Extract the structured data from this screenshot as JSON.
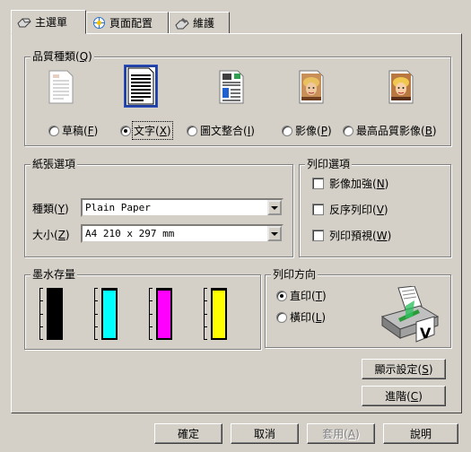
{
  "tabs": [
    {
      "label": "主選單",
      "icon": "main-menu-icon",
      "active": true
    },
    {
      "label": "頁面配置",
      "icon": "page-layout-icon",
      "active": false
    },
    {
      "label": "維護",
      "icon": "maintenance-icon",
      "active": false
    }
  ],
  "quality": {
    "title": "品質種類(",
    "title_key": "Q",
    "title_end": ")",
    "options": [
      {
        "label": "草稿(",
        "key": "F",
        "end": ")",
        "selected": false
      },
      {
        "label": "文字(",
        "key": "X",
        "end": ")",
        "selected": true
      },
      {
        "label": "圖文整合(",
        "key": "I",
        "end": ")",
        "selected": false
      },
      {
        "label": "影像(",
        "key": "P",
        "end": ")",
        "selected": false
      },
      {
        "label": "最高品質影像(",
        "key": "B",
        "end": ")",
        "selected": false
      }
    ]
  },
  "paper": {
    "title": "紙張選項",
    "type_label": "種類(",
    "type_key": "Y",
    "type_end": ")",
    "type_value": "Plain Paper",
    "size_label": "大小(",
    "size_key": "Z",
    "size_end": ")",
    "size_value": "A4 210 x 297 mm"
  },
  "print_options": {
    "title": "列印選項",
    "items": [
      {
        "label": "影像加強(",
        "key": "N",
        "end": ")",
        "checked": false
      },
      {
        "label": "反序列印(",
        "key": "V",
        "end": ")",
        "checked": false
      },
      {
        "label": "列印預視(",
        "key": "W",
        "end": ")",
        "checked": false
      }
    ]
  },
  "ink": {
    "title": "墨水存量",
    "cartridges": [
      {
        "color": "#000000",
        "level": 1.0
      },
      {
        "color": "#00ffff",
        "level": 1.0
      },
      {
        "color": "#ff00ff",
        "level": 1.0
      },
      {
        "color": "#ffff00",
        "level": 1.0
      }
    ]
  },
  "orientation": {
    "title": "列印方向",
    "options": [
      {
        "label": "直印(",
        "key": "T",
        "end": ")",
        "selected": true
      },
      {
        "label": "橫印(",
        "key": "L",
        "end": ")",
        "selected": false
      }
    ]
  },
  "side_buttons": {
    "display": "顯示設定(",
    "display_key": "S",
    "display_end": ")",
    "advanced": "進階(",
    "advanced_key": "C",
    "advanced_end": ")"
  },
  "footer": {
    "ok": "確定",
    "cancel": "取消",
    "apply": "套用(",
    "apply_key": "A",
    "apply_end": ")",
    "help": "說明"
  }
}
